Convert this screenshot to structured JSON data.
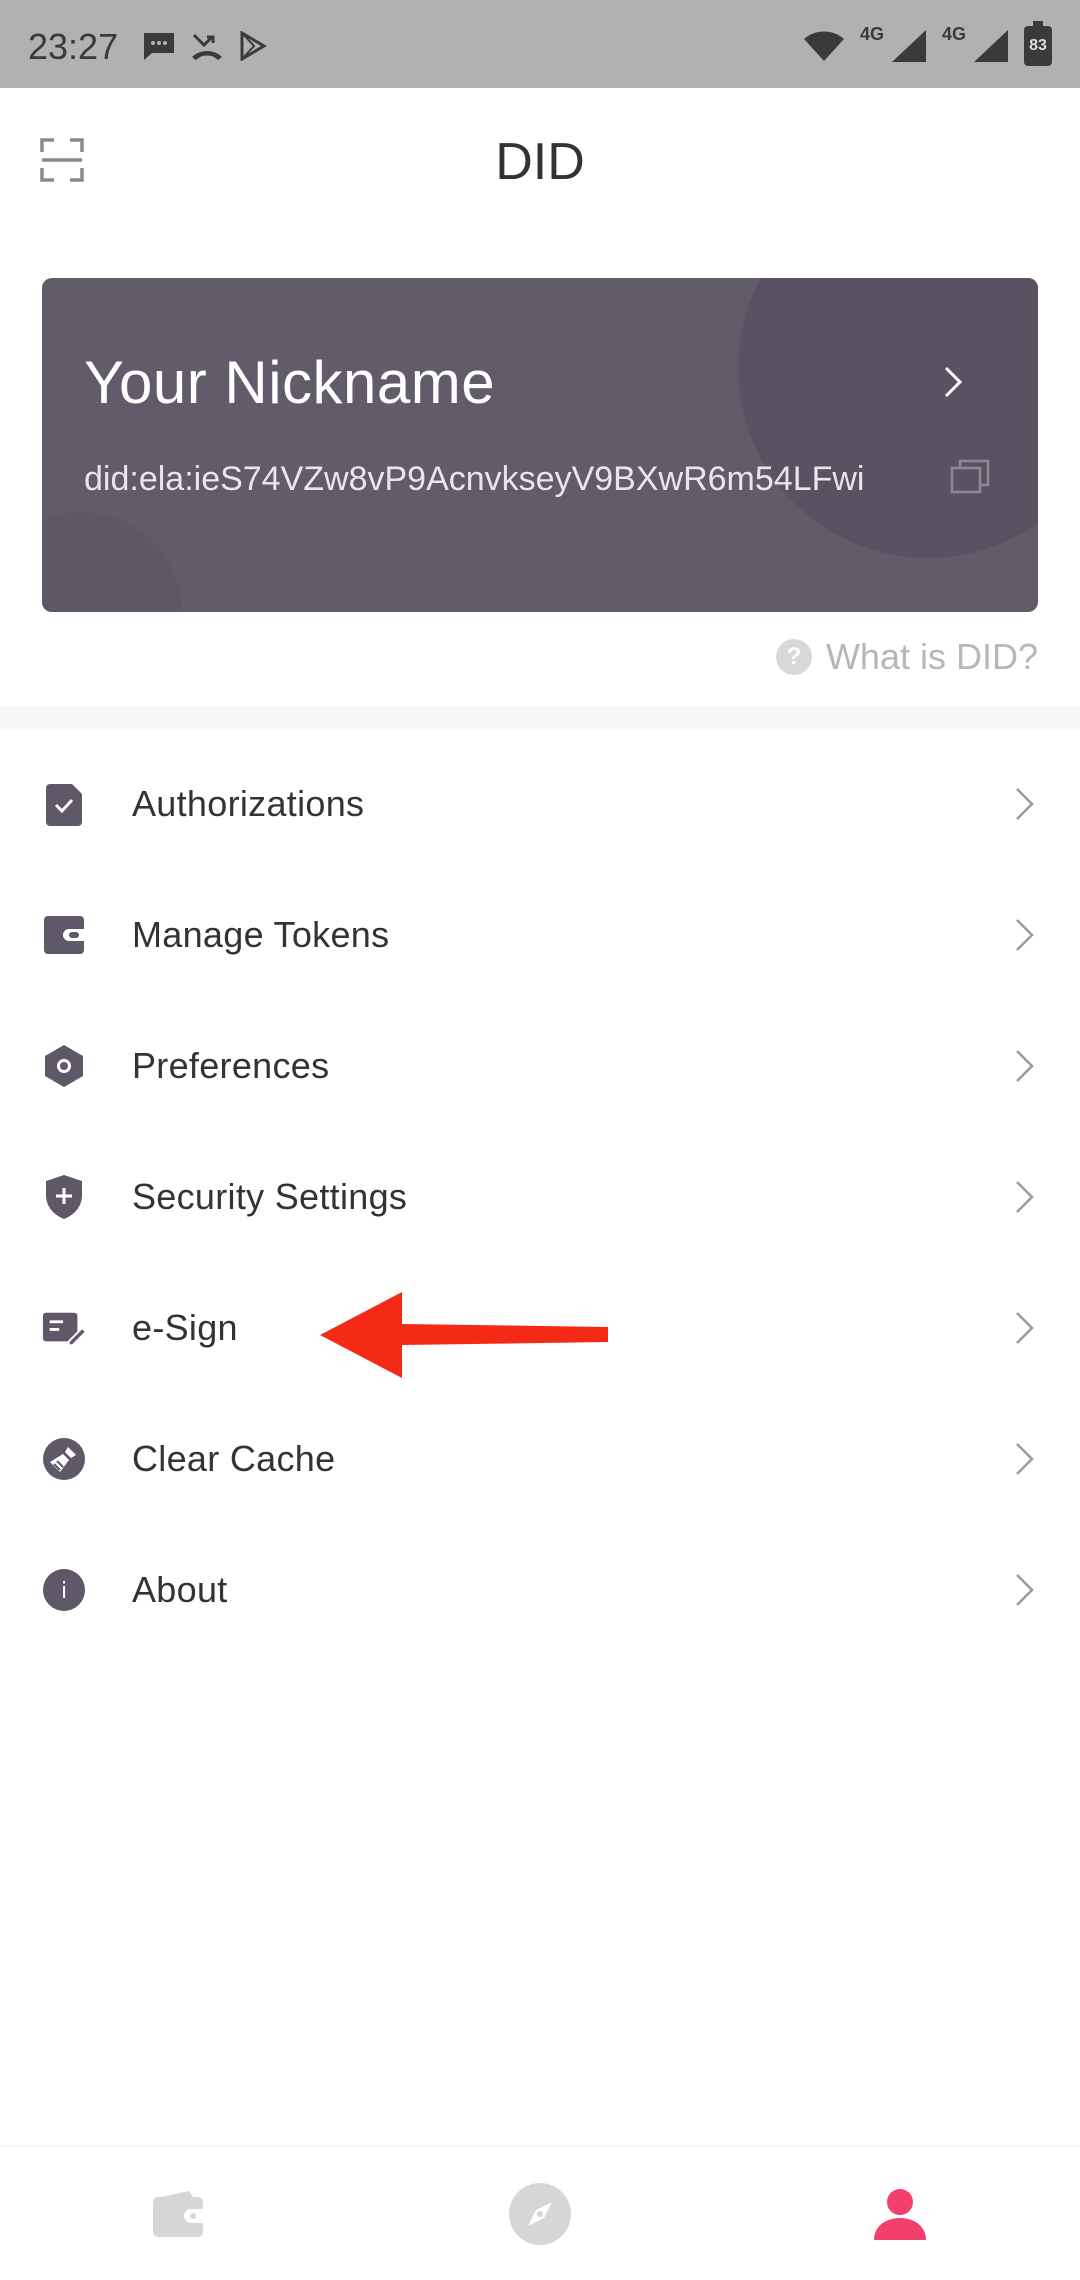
{
  "status_bar": {
    "time": "23:27",
    "network_label_1": "4G",
    "network_label_2": "4G",
    "battery": "83"
  },
  "header": {
    "title": "DID",
    "scan_icon": "scan-icon"
  },
  "did_card": {
    "nickname": "Your Nickname",
    "did": "did:ela:ieS74VZw8vP9AcnvkseyV9BXwR6m54LFwi",
    "card_bg": "#625b6a"
  },
  "help_link": {
    "label": "What is DID?",
    "glyph": "?"
  },
  "menu": {
    "items": [
      {
        "label": "Authorizations",
        "icon": "authorization-check-icon"
      },
      {
        "label": "Manage Tokens",
        "icon": "wallet-icon"
      },
      {
        "label": "Preferences",
        "icon": "hexagon-settings-icon"
      },
      {
        "label": "Security Settings",
        "icon": "shield-plus-icon"
      },
      {
        "label": "e-Sign",
        "icon": "sign-pen-icon"
      },
      {
        "label": "Clear Cache",
        "icon": "broom-icon"
      },
      {
        "label": "About",
        "icon": "info-icon"
      }
    ]
  },
  "about_glyph": "i",
  "bottom_nav": {
    "items": [
      {
        "name": "wallet",
        "icon": "wallet-tab-icon",
        "active": false
      },
      {
        "name": "explore",
        "icon": "compass-icon",
        "active": false
      },
      {
        "name": "profile",
        "icon": "person-icon",
        "active": true
      }
    ]
  },
  "colors": {
    "icon": "#5f5868",
    "active_tab": "#f23f6d",
    "inactive_tab": "#d6d6d6",
    "annotation_arrow": "#f52a16"
  }
}
